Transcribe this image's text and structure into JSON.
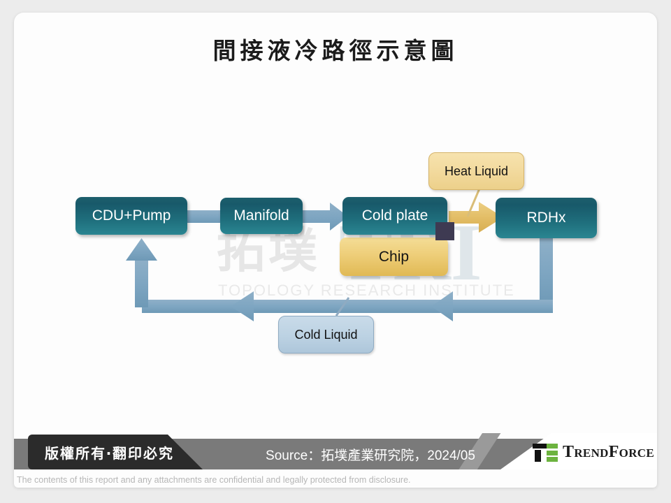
{
  "slide": {
    "title": "間接液冷路徑示意圖"
  },
  "watermark": {
    "cn": "拓墣",
    "abbr": "TRI",
    "sub": "TOPOLOGY RESEARCH INSTITUTE"
  },
  "diagram": {
    "nodes": [
      {
        "id": "cdu",
        "label": "CDU+Pump",
        "color": "#1d5f6c",
        "text_color": "#ffffff"
      },
      {
        "id": "man",
        "label": "Manifold",
        "color": "#1d5f6c",
        "text_color": "#ffffff"
      },
      {
        "id": "cold",
        "label": "Cold plate",
        "color": "#1d5f6c",
        "text_color": "#ffffff"
      },
      {
        "id": "chip",
        "label": "Chip",
        "color": "#e9c96d",
        "text_color": "#141414"
      },
      {
        "id": "rdhx",
        "label": "RDHx",
        "color": "#1d5f6c",
        "text_color": "#ffffff"
      }
    ],
    "callouts": [
      {
        "id": "heat",
        "label": "Heat Liquid",
        "color": "#f2d99c"
      },
      {
        "id": "cold",
        "label": "Cold Liquid",
        "color": "#bcd2e3"
      }
    ],
    "flow_colors": {
      "cold_liquid": "#7fa6c2",
      "heat_liquid": "#e0bc6a",
      "chip_marker": "#3e3a52"
    }
  },
  "footer": {
    "copyright": "版權所有‧翻印必究",
    "source": "Source：拓墣產業研究院，2024/05",
    "brand": "TrendForce",
    "disclaimer": "The contents of this report and any attachments are confidential and legally protected from disclosure."
  }
}
